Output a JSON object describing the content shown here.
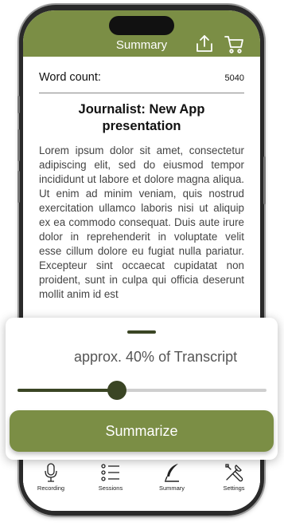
{
  "header": {
    "title": "Summary"
  },
  "document": {
    "word_count_label": "Word count:",
    "word_count_value": "5040",
    "title": "Journalist: New App presentation",
    "body": "Lorem ipsum dolor sit amet, consectetur adipiscing elit, sed do eiusmod tempor incididunt ut labore et dolore magna aliqua. Ut enim ad minim veniam, quis nostrud exercitation ullamco laboris nisi ut aliquip ex ea commodo consequat. Duis aute irure dolor in reprehenderit in voluptate velit esse cillum dolore eu fugiat nulla pariatur. Excepteur sint occaecat cupidatat non proident, sunt in culpa qui officia deserunt mollit anim id est"
  },
  "sheet": {
    "approx_text": "approx. 40% of Transcript",
    "slider_value": 0.4,
    "button_label": "Summarize"
  },
  "tabbar": {
    "items": [
      {
        "label": "Recording",
        "icon": "microphone-icon"
      },
      {
        "label": "Sessions",
        "icon": "list-icon"
      },
      {
        "label": "Summary",
        "icon": "quill-icon"
      },
      {
        "label": "Settings",
        "icon": "tools-icon"
      }
    ]
  },
  "colors": {
    "accent": "#7b8e45",
    "dark_accent": "#3a4524"
  }
}
